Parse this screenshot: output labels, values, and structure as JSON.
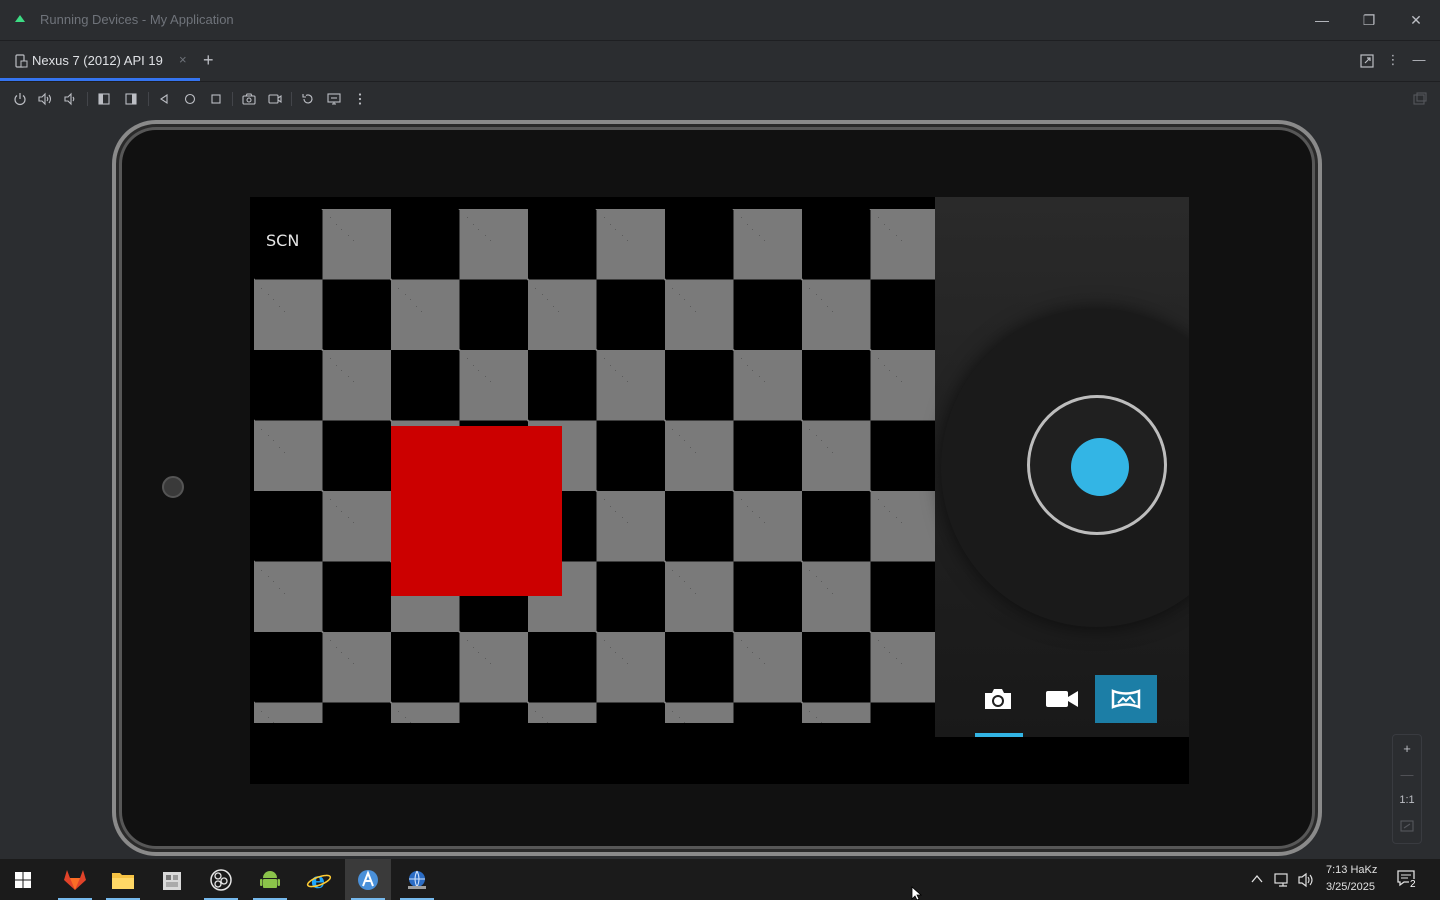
{
  "window": {
    "title": "Running Devices - My Application",
    "minimize_icon": "—",
    "restore_icon": "❐",
    "close_icon": "✕"
  },
  "tabs": [
    {
      "label": "Nexus 7 (2012) API 19",
      "close": "×",
      "icon": "device-icon"
    }
  ],
  "tab_add": "+",
  "right_tools": [
    "⋮",
    "—"
  ],
  "toolbar": {
    "icons": [
      "power-icon",
      "volume-up-icon",
      "volume-down-icon",
      "rotate-left-icon",
      "rotate-right-icon",
      "back-icon",
      "home-icon",
      "overview-icon",
      "screenshot-icon",
      "screen-record-icon",
      "reset-icon",
      "toggle-display-icon",
      "more-icon"
    ]
  },
  "device": {
    "scene_label": "SCN",
    "accent": "#33b5e5",
    "modes": [
      "camera-icon",
      "video-icon",
      "panorama-icon"
    ],
    "active_mode": 2
  },
  "zoom": {
    "in": "+",
    "out": "—",
    "actual": "1:1"
  },
  "taskbar": {
    "apps": [
      "start-icon",
      "gitlab-icon",
      "file-explorer-icon",
      "package-icon",
      "obs-icon",
      "android-icon",
      "internet-explorer-icon",
      "android-studio-icon",
      "network-globe-icon"
    ],
    "time": "7:13 HaKz",
    "date": "3/25/2025",
    "notification_count": "2"
  }
}
